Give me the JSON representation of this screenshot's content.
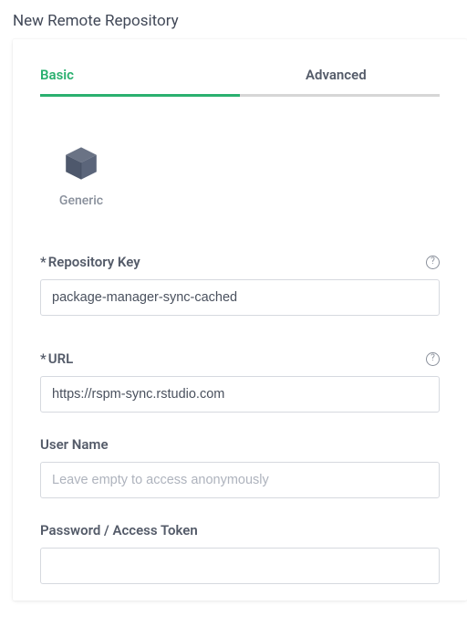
{
  "page": {
    "title": "New Remote Repository"
  },
  "tabs": {
    "basic": "Basic",
    "advanced": "Advanced"
  },
  "packageType": {
    "label": "Generic"
  },
  "fields": {
    "repoKey": {
      "label": "Repository Key",
      "required": "*",
      "value": "package-manager-sync-cached"
    },
    "url": {
      "label": "URL",
      "required": "*",
      "value": "https://rspm-sync.rstudio.com"
    },
    "userName": {
      "label": "User Name",
      "placeholder": "Leave empty to access anonymously",
      "value": ""
    },
    "password": {
      "label": "Password / Access Token",
      "value": ""
    }
  },
  "icons": {
    "help": "?"
  }
}
